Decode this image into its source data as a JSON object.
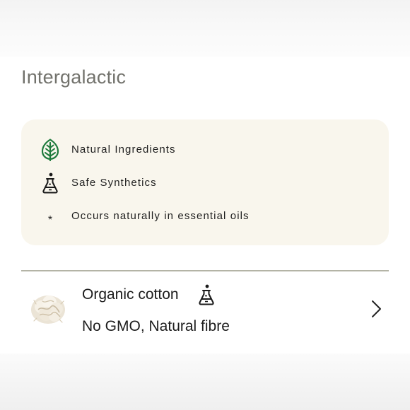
{
  "brand": {
    "title": "Intergalactic"
  },
  "legend": {
    "items": [
      {
        "icon": "leaf-icon",
        "label": "Natural Ingredients",
        "color": "#1e7a3c"
      },
      {
        "icon": "flask-icon",
        "label": "Safe Synthetics",
        "color": "#1a1a1a"
      },
      {
        "icon": "asterisk",
        "symbol": "*",
        "label": "Occurs naturally in essential oils"
      }
    ],
    "background": "#f9f6ed"
  },
  "ingredients": [
    {
      "name": "Organic cotton",
      "badge_icon": "flask-icon",
      "description": "No GMO, Natural fibre",
      "thumbnail": "cotton-thumbnail",
      "action_icon": "chevron-right-icon"
    }
  ],
  "colors": {
    "title": "#72726c",
    "divider": "#b4b4a6",
    "leaf": "#1e7a3c"
  }
}
